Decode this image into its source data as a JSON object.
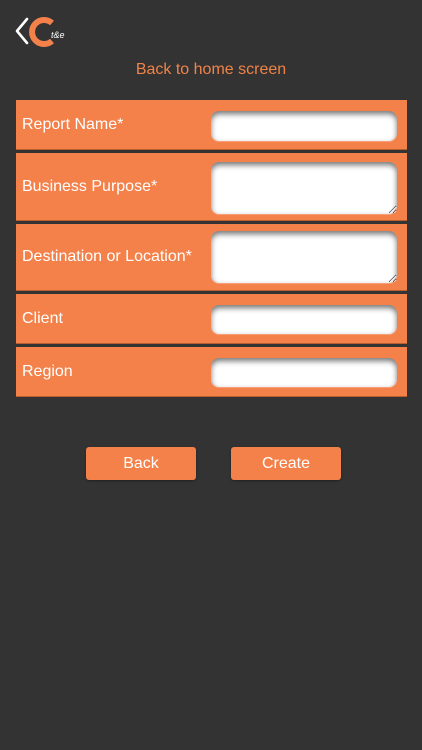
{
  "header": {
    "logo_text": "t&e",
    "back_home_label": "Back to home screen"
  },
  "form": {
    "fields": [
      {
        "label": "Report Name*",
        "value": ""
      },
      {
        "label": "Business Purpose*",
        "value": ""
      },
      {
        "label": "Destination or Location*",
        "value": ""
      },
      {
        "label": "Client",
        "value": ""
      },
      {
        "label": "Region",
        "value": ""
      }
    ]
  },
  "actions": {
    "back_label": "Back",
    "create_label": "Create"
  },
  "colors": {
    "background": "#333333",
    "accent": "#f4814a",
    "link": "#f08348"
  }
}
